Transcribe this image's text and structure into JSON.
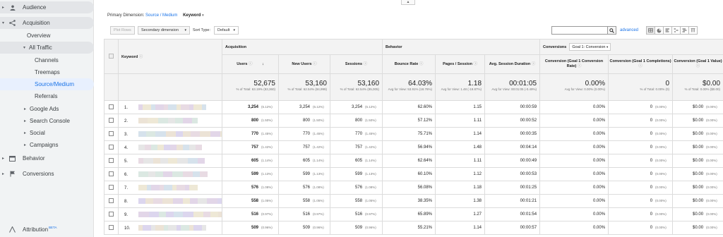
{
  "sidebar": {
    "audience": "Audience",
    "acquisition": "Acquisition",
    "overview": "Overview",
    "all_traffic": "All Traffic",
    "channels": "Channels",
    "treemaps": "Treemaps",
    "source_medium": "Source/Medium",
    "referrals": "Referrals",
    "google_ads": "Google Ads",
    "search_console": "Search Console",
    "social": "Social",
    "campaigns": "Campaigns",
    "behavior": "Behavior",
    "conversions": "Conversions",
    "attribution": "Attribution",
    "beta": "BETA"
  },
  "toolbar": {
    "primary_dimension_label": "Primary Dimension:",
    "primary_dimension_value": "Source / Medium",
    "keyword": "Keyword",
    "plot_rows": "Plot Rows",
    "secondary_dimension": "Secondary dimension",
    "sort_type_label": "Sort Type:",
    "sort_type_value": "Default",
    "advanced": "advanced"
  },
  "table": {
    "groups": {
      "acquisition": "Acquisition",
      "behavior": "Behavior",
      "conversions": "Conversions",
      "goal_select": "Goal 1: Conversion"
    },
    "headers": {
      "keyword": "Keyword",
      "users": "Users",
      "new_users": "New Users",
      "sessions": "Sessions",
      "bounce_rate": "Bounce Rate",
      "pages_session": "Pages / Session",
      "avg_session": "Avg. Session Duration",
      "conv_rate": "Conversion (Goal 1 Conversion Rate)",
      "completions": "Conversion (Goal 1 Completions)",
      "value": "Conversion (Goal 1 Value)"
    },
    "totals": {
      "users": "52,675",
      "users_sub": "% of Total: 63.19% (83,360)",
      "new_users": "53,160",
      "new_users_sub": "% of Total: 62.54% (84,999)",
      "sessions": "53,160",
      "sessions_sub": "% of Total: 62.54% (85,005)",
      "bounce_rate": "64.03%",
      "bounce_rate_sub": "Avg for View: 53.91% (18.76%)",
      "pages_session": "1.18",
      "pages_session_sub": "Avg for View: 1.48 (-19.87%)",
      "avg_session": "00:01:05",
      "avg_session_sub": "Avg for View: 00:01:05 (-0.49%)",
      "conv_rate": "0.00%",
      "conv_rate_sub": "Avg for View: 0.00% (0.00%)",
      "completions": "0",
      "completions_sub": "% of Total: 0.00% (0)",
      "value": "$0.00",
      "value_sub": "% of Total: 0.00% ($0.00)"
    },
    "rows": [
      {
        "n": "1.",
        "users": "3,254",
        "up": "(6.12%)",
        "new": "3,254",
        "np": "(6.12%)",
        "sess": "3,254",
        "sp": "(6.12%)",
        "br": "62.60%",
        "ps": "1.15",
        "dur": "00:00:59",
        "cr": "0.00%",
        "comp": "0",
        "cp": "(0.00%)",
        "val": "$0.00",
        "vp": "(0.00%)"
      },
      {
        "n": "2.",
        "users": "800",
        "up": "(1.50%)",
        "new": "800",
        "np": "(1.50%)",
        "sess": "800",
        "sp": "(1.50%)",
        "br": "57.12%",
        "ps": "1.11",
        "dur": "00:00:52",
        "cr": "0.00%",
        "comp": "0",
        "cp": "(0.00%)",
        "val": "$0.00",
        "vp": "(0.00%)"
      },
      {
        "n": "3.",
        "users": "770",
        "up": "(1.45%)",
        "new": "770",
        "np": "(1.45%)",
        "sess": "770",
        "sp": "(1.45%)",
        "br": "75.71%",
        "ps": "1.14",
        "dur": "00:00:35",
        "cr": "0.00%",
        "comp": "0",
        "cp": "(0.00%)",
        "val": "$0.00",
        "vp": "(0.00%)"
      },
      {
        "n": "4.",
        "users": "757",
        "up": "(1.42%)",
        "new": "757",
        "np": "(1.42%)",
        "sess": "757",
        "sp": "(1.42%)",
        "br": "56.94%",
        "ps": "1.48",
        "dur": "00:04:14",
        "cr": "0.00%",
        "comp": "0",
        "cp": "(0.00%)",
        "val": "$0.00",
        "vp": "(0.00%)"
      },
      {
        "n": "5.",
        "users": "605",
        "up": "(1.14%)",
        "new": "605",
        "np": "(1.14%)",
        "sess": "605",
        "sp": "(1.14%)",
        "br": "62.64%",
        "ps": "1.11",
        "dur": "00:00:49",
        "cr": "0.00%",
        "comp": "0",
        "cp": "(0.00%)",
        "val": "$0.00",
        "vp": "(0.00%)"
      },
      {
        "n": "6.",
        "users": "599",
        "up": "(1.13%)",
        "new": "599",
        "np": "(1.13%)",
        "sess": "599",
        "sp": "(1.13%)",
        "br": "60.10%",
        "ps": "1.12",
        "dur": "00:00:53",
        "cr": "0.00%",
        "comp": "0",
        "cp": "(0.00%)",
        "val": "$0.00",
        "vp": "(0.00%)"
      },
      {
        "n": "7.",
        "users": "576",
        "up": "(1.08%)",
        "new": "576",
        "np": "(1.08%)",
        "sess": "576",
        "sp": "(1.08%)",
        "br": "56.08%",
        "ps": "1.18",
        "dur": "00:01:25",
        "cr": "0.00%",
        "comp": "0",
        "cp": "(0.00%)",
        "val": "$0.00",
        "vp": "(0.00%)"
      },
      {
        "n": "8.",
        "users": "558",
        "up": "(1.05%)",
        "new": "558",
        "np": "(1.05%)",
        "sess": "558",
        "sp": "(1.05%)",
        "br": "38.35%",
        "ps": "1.38",
        "dur": "00:01:21",
        "cr": "0.00%",
        "comp": "0",
        "cp": "(0.00%)",
        "val": "$0.00",
        "vp": "(0.00%)"
      },
      {
        "n": "9.",
        "users": "516",
        "up": "(0.97%)",
        "new": "516",
        "np": "(0.97%)",
        "sess": "516",
        "sp": "(0.97%)",
        "br": "65.89%",
        "ps": "1.27",
        "dur": "00:01:54",
        "cr": "0.00%",
        "comp": "0",
        "cp": "(0.00%)",
        "val": "$0.00",
        "vp": "(0.00%)"
      },
      {
        "n": "10.",
        "users": "509",
        "up": "(0.96%)",
        "new": "509",
        "np": "(0.96%)",
        "sess": "509",
        "sp": "(0.96%)",
        "br": "55.21%",
        "ps": "1.14",
        "dur": "00:00:57",
        "cr": "0.00%",
        "comp": "0",
        "cp": "(0.00%)",
        "val": "$0.00",
        "vp": "(0.00%)"
      }
    ]
  },
  "colors": {
    "link": "#1a73e8",
    "sidebar_bg": "#f1f3f4",
    "selected_bg": "#e8f0fe"
  }
}
